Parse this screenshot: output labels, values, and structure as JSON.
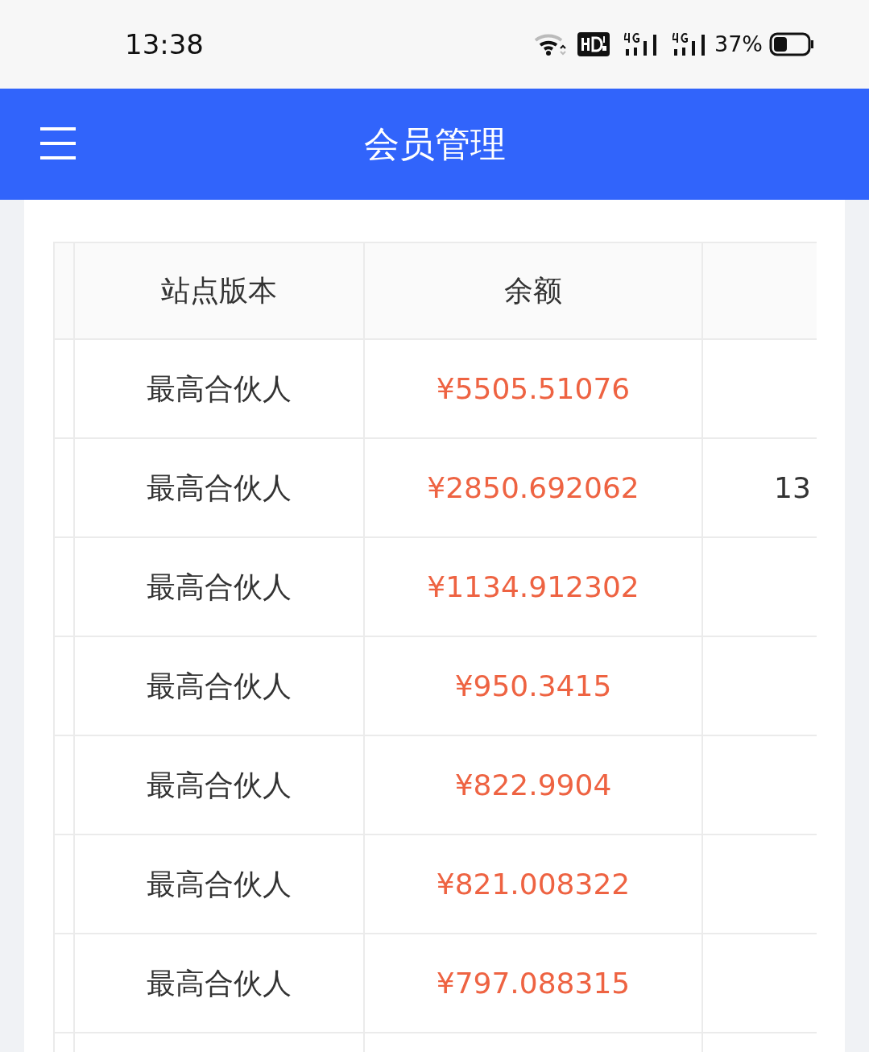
{
  "status_bar": {
    "time": "13:38",
    "battery": "37%"
  },
  "header": {
    "title": "会员管理"
  },
  "table": {
    "columns": [
      "站点版本",
      "余额"
    ],
    "rows": [
      {
        "version": "最高合伙人",
        "balance": "¥5505.51076"
      },
      {
        "version": "最高合伙人",
        "balance": "¥2850.692062",
        "column_3": "13"
      },
      {
        "version": "最高合伙人",
        "balance": "¥1134.912302"
      },
      {
        "version": "最高合伙人",
        "balance": "¥950.3415"
      },
      {
        "version": "最高合伙人",
        "balance": "¥822.9904"
      },
      {
        "version": "最高合伙人",
        "balance": "¥821.008322"
      },
      {
        "version": "最高合伙人",
        "balance": "¥797.088315"
      }
    ]
  }
}
